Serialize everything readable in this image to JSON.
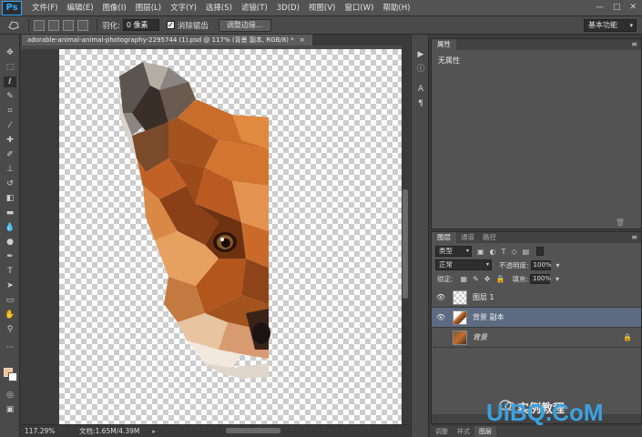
{
  "app": {
    "logo": "Ps",
    "menu": [
      "文件(F)",
      "编辑(E)",
      "图像(I)",
      "图层(L)",
      "文字(Y)",
      "选择(S)",
      "滤镜(T)",
      "3D(D)",
      "视图(V)",
      "窗口(W)",
      "帮助(H)"
    ],
    "window_controls": [
      "—",
      "□",
      "✕"
    ]
  },
  "options": {
    "feather_label": "羽化:",
    "feather_value": "0 像素",
    "antialias_label": "消除锯齿",
    "refine_edge_button": "调整边缘...",
    "workspace": "基本功能"
  },
  "document": {
    "tab_title": "adorable-animal-animal-photography-2295744 (1).psd @ 117% (背景 副本, RGB/8) *",
    "zoom": "117.29%",
    "doc_info": "文档:1.65M/4.39M"
  },
  "colors": {
    "foreground": "#f7c38e",
    "background": "#ffffff",
    "selected_layer": "#5d6b82"
  },
  "properties": {
    "tabs": [
      "属性"
    ],
    "content": "无属性"
  },
  "layers": {
    "tabs": [
      "图层",
      "通道",
      "路径"
    ],
    "filter_kind": "类型",
    "blend_mode": "正常",
    "opacity_label": "不透明度:",
    "opacity_value": "100%",
    "lock_label": "锁定:",
    "fill_label": "填充:",
    "fill_value": "100%",
    "items": [
      {
        "name": "图层 1",
        "visible": true,
        "selected": false
      },
      {
        "name": "背景 副本",
        "visible": true,
        "selected": true
      },
      {
        "name": "背景",
        "visible": false,
        "selected": false,
        "locked": true
      }
    ]
  },
  "bottom_tabs": [
    "调整",
    "样式",
    "图层"
  ],
  "watermark": {
    "cn": "实例教程",
    "en": "UiBQ.CoM"
  }
}
